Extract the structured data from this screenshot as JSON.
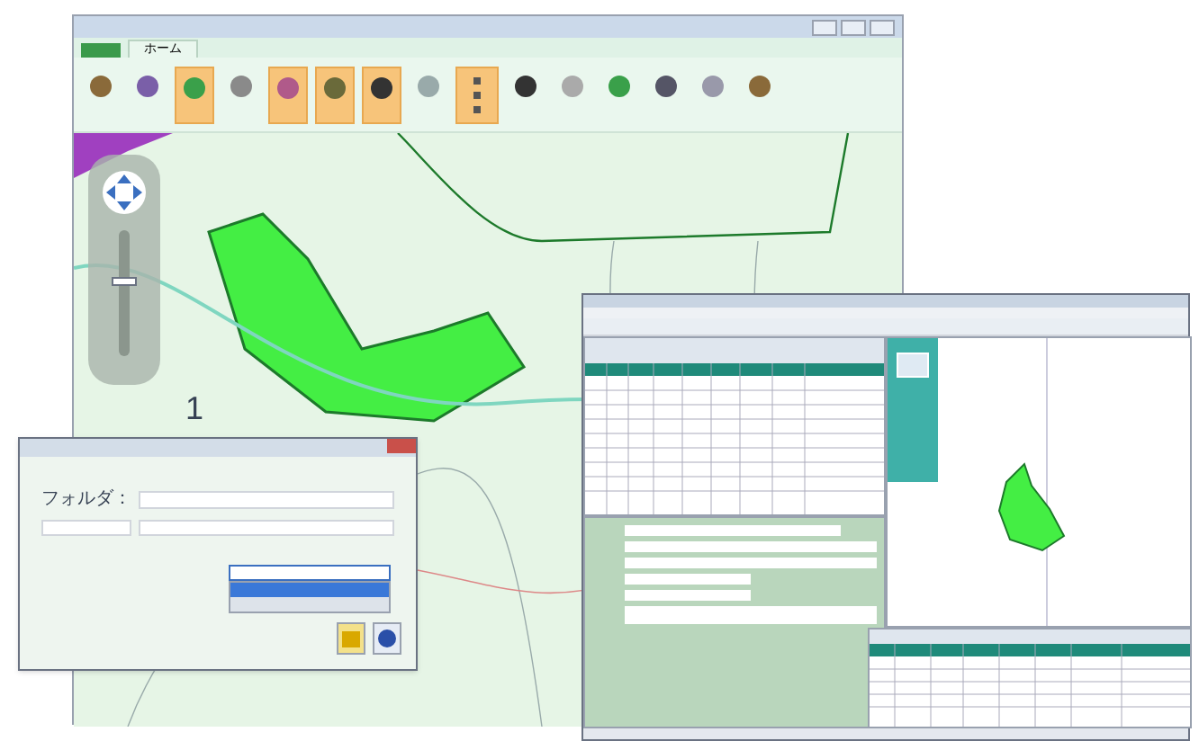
{
  "main_window": {
    "tabs": [
      {
        "label": "ホーム",
        "selected": true
      }
    ],
    "ribbon_buttons": [
      {
        "kind": "large",
        "selected": false
      },
      {
        "kind": "large",
        "selected": false
      },
      {
        "kind": "large",
        "selected": true
      },
      {
        "kind": "large",
        "selected": false
      },
      {
        "kind": "large",
        "selected": true
      },
      {
        "kind": "large",
        "selected": true
      },
      {
        "kind": "large",
        "selected": true
      },
      {
        "kind": "large",
        "selected": false
      },
      {
        "kind": "stack",
        "selected": true
      },
      {
        "kind": "large",
        "selected": false
      },
      {
        "kind": "large",
        "selected": false
      },
      {
        "kind": "large",
        "selected": false
      },
      {
        "kind": "large",
        "selected": false
      },
      {
        "kind": "large",
        "selected": false
      },
      {
        "kind": "large",
        "selected": false
      }
    ],
    "map_labels": [
      {
        "text": "1"
      }
    ],
    "zoom_slider": {
      "level": 0.6
    }
  },
  "dialog": {
    "folder_label": "フォルダ：",
    "dropdown_options": [
      {
        "selected": true
      },
      {
        "selected": false
      }
    ]
  }
}
